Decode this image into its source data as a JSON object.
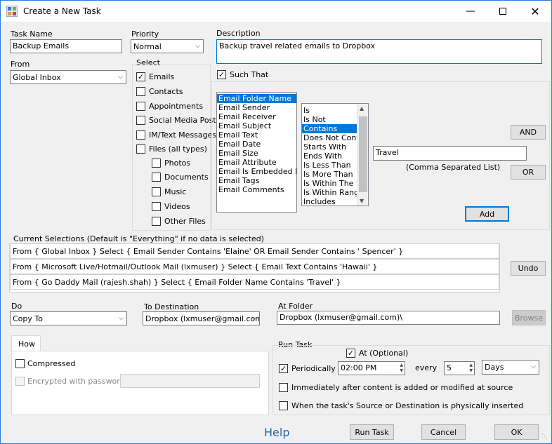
{
  "window": {
    "title": "Create a New Task",
    "min_icon": "minimize-icon",
    "max_icon": "maximize-icon",
    "close_icon": "close-icon"
  },
  "task_name": {
    "label": "Task Name",
    "value": "Backup Emails"
  },
  "priority": {
    "label": "Priority",
    "value": "Normal"
  },
  "description": {
    "label": "Description",
    "value": "Backup travel related emails to Dropbox"
  },
  "from": {
    "label": "From",
    "value": "Global Inbox"
  },
  "select": {
    "label": "Select",
    "items": [
      {
        "label": "Emails",
        "checked": "✓"
      },
      {
        "label": "Contacts",
        "checked": ""
      },
      {
        "label": "Appointments",
        "checked": ""
      },
      {
        "label": "Social Media Posts",
        "checked": ""
      },
      {
        "label": "IM/Text Messages",
        "checked": ""
      },
      {
        "label": "Files (all types)",
        "checked": ""
      }
    ],
    "sub_items": [
      {
        "label": "Photos"
      },
      {
        "label": "Documents"
      },
      {
        "label": "Music"
      },
      {
        "label": "Videos"
      },
      {
        "label": "Other Files"
      }
    ]
  },
  "such_that": {
    "label": "Such That",
    "checked": "✓"
  },
  "fields": [
    "Email Folder Name",
    "Email Sender",
    "Email Receiver",
    "Email Subject",
    "Email Text",
    "Email Date",
    "Email Size",
    "Email Attribute",
    "Email Is Embedded In",
    "Email Tags",
    "Email Comments"
  ],
  "operators": [
    "Is",
    "Is Not",
    "Contains",
    "Does Not Conta",
    "Starts With",
    "Ends With",
    "Is Less Than",
    "Is More Than",
    "Is Within The La",
    "Is Within Range",
    "Includes"
  ],
  "condition_value": {
    "value": "Travel",
    "hint": "(Comma Separated List)"
  },
  "buttons": {
    "and": "AND",
    "or": "OR",
    "add": "Add",
    "undo": "Undo",
    "browse": "Browse",
    "run_task": "Run Task",
    "cancel": "Cancel",
    "ok": "OK",
    "help": "Help"
  },
  "current_selections": {
    "label": "Current Selections (Default is \"Everything\" if no data is selected)",
    "rows": [
      "From { Global Inbox } Select { Email Sender Contains 'Elaine' OR Email Sender Contains ' Spencer' }",
      "From { Microsoft Live/Hotmail/Outlook Mail (lxmuser) } Select { Email Text Contains 'Hawaii' }",
      "From { Go Daddy Mail (rajesh.shah) } Select { Email Folder Name Contains 'Travel' }"
    ]
  },
  "do": {
    "label": "Do",
    "value": "Copy To"
  },
  "destination": {
    "label": "To Destination",
    "value": "Dropbox (lxmuser@gmail.com)"
  },
  "at_folder": {
    "label": "At Folder",
    "value": "Dropbox (lxmuser@gmail.com)\\"
  },
  "how": {
    "tab": "How",
    "compressed": "Compressed",
    "encrypted": "Encrypted with password"
  },
  "run_task": {
    "label": "Run Task",
    "at_label": "At  (Optional)",
    "periodically": "Periodically",
    "time": "02:00 PM",
    "every": "every",
    "every_value": "5",
    "unit": "Days",
    "immediately": "Immediately after content is added or modified at source",
    "inserted": "When the task's Source or Destination is physically inserted"
  }
}
